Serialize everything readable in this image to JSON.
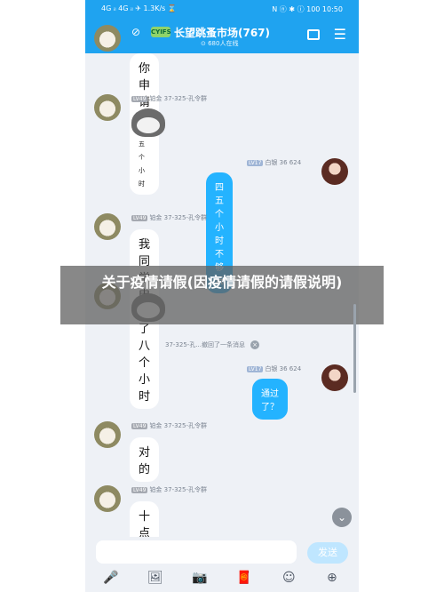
{
  "statusbar": {
    "left": "4G ᵢₗ 4G ᵢₗ ✈ 1.3K/s ⌛",
    "right": "N ⓝ ✱ ⓘ 100 10:50"
  },
  "header": {
    "back_icon": "‹",
    "group_badge": "CYIFS",
    "title": "长望跳蚤市场(767)",
    "online": "⊙ 680人在线",
    "icon_shield": "⊘",
    "icon_menu": "☰"
  },
  "messages": [
    {
      "type": "text-left",
      "text_big": "你申请",
      "text_small": "个四五个小时"
    },
    {
      "type": "sticker-left",
      "level": "LV49",
      "rank": "铂金",
      "name": "37-325-孔令群"
    },
    {
      "type": "text-right",
      "level": "LV17",
      "rank": "白银",
      "name": "36 624",
      "text": "四五个小时不够玩"
    },
    {
      "type": "text-left",
      "level": "LV49",
      "rank": "铂金",
      "name": "37-325-孔令群",
      "text": "我同学申请了八个小时"
    },
    {
      "type": "sticker-left-partial"
    },
    {
      "type": "recall",
      "text": "37-325-孔...撤回了一条消息",
      "close": "×"
    },
    {
      "type": "text-right",
      "level": "LV17",
      "rank": "白银",
      "name": "36 624",
      "text": "通过了？"
    },
    {
      "type": "text-left",
      "level": "LV49",
      "rank": "铂金",
      "name": "37-325-孔令群",
      "text": "对的"
    },
    {
      "type": "text-left",
      "level": "LV49",
      "rank": "铂金",
      "name": "37-325-孔令群",
      "text": "十点到六点"
    }
  ],
  "overlay": {
    "text": "关于疫情请假(因疫情请假的请假说明)"
  },
  "input": {
    "send_label": "发送",
    "placeholder": ""
  },
  "bottombar": {
    "icons": [
      "🎤",
      "🖼",
      "📷",
      "🧧",
      "☺",
      "⊕"
    ]
  },
  "colors": {
    "header_blue": "#1fa3f0",
    "bubble_blue": "#24b3ff",
    "bg": "#eef1f6"
  }
}
